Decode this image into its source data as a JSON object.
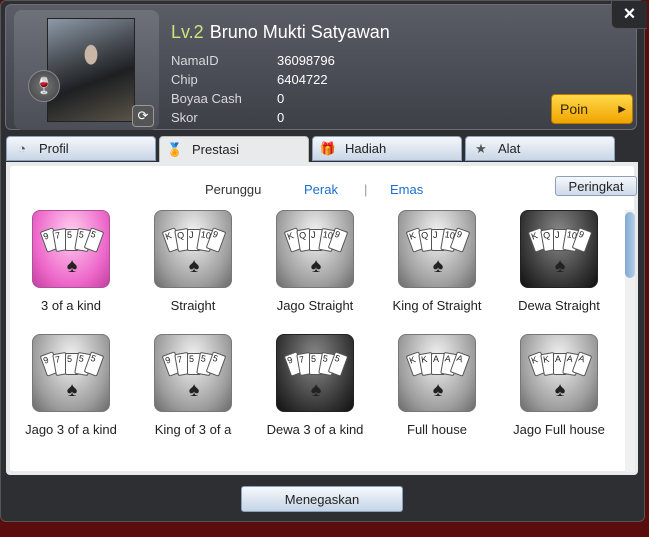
{
  "profile": {
    "level": "Lv.2",
    "name": "Bruno Mukti Satyawan",
    "fields": [
      {
        "label": "NamaID",
        "value": "36098796"
      },
      {
        "label": "Chip",
        "value": "6404722"
      },
      {
        "label": "Boyaa Cash",
        "value": "0"
      },
      {
        "label": "Skor",
        "value": "0"
      }
    ],
    "poin_label": "Poin"
  },
  "close_label": "×",
  "tabs": [
    {
      "label": "Profil",
      "icon": "gauge-icon"
    },
    {
      "label": "Prestasi",
      "icon": "medal-icon"
    },
    {
      "label": "Hadiah",
      "icon": "gift-icon"
    },
    {
      "label": "Alat",
      "icon": "star-icon"
    }
  ],
  "filters": {
    "label": "Perunggu",
    "options": [
      "Perak",
      "Emas"
    ]
  },
  "rank_button": "Peringkat",
  "achievements": [
    {
      "label": "3 of a kind",
      "style": "gold",
      "cards": [
        "9",
        "7",
        "5",
        "5",
        "5"
      ]
    },
    {
      "label": "Straight",
      "style": "silver",
      "cards": [
        "K",
        "Q",
        "J",
        "10",
        "9"
      ]
    },
    {
      "label": "Jago Straight",
      "style": "silver",
      "cards": [
        "K",
        "Q",
        "J",
        "10",
        "9"
      ]
    },
    {
      "label": "King of Straight",
      "style": "silver",
      "cards": [
        "K",
        "Q",
        "J",
        "10",
        "9"
      ]
    },
    {
      "label": "Dewa Straight",
      "style": "dark",
      "cards": [
        "K",
        "Q",
        "J",
        "10",
        "9"
      ]
    },
    {
      "label": "Jago 3 of a kind",
      "style": "silver",
      "cards": [
        "9",
        "7",
        "5",
        "5",
        "5"
      ]
    },
    {
      "label": "King of 3 of a",
      "style": "silver",
      "cards": [
        "9",
        "7",
        "5",
        "5",
        "5"
      ]
    },
    {
      "label": "Dewa 3 of a kind",
      "style": "dark",
      "cards": [
        "9",
        "7",
        "5",
        "5",
        "5"
      ]
    },
    {
      "label": "Full house",
      "style": "silver",
      "cards": [
        "K",
        "K",
        "A",
        "A",
        "A"
      ]
    },
    {
      "label": "Jago Full house",
      "style": "silver",
      "cards": [
        "K",
        "K",
        "A",
        "A",
        "A"
      ]
    }
  ],
  "confirm_button": "Menegaskan"
}
